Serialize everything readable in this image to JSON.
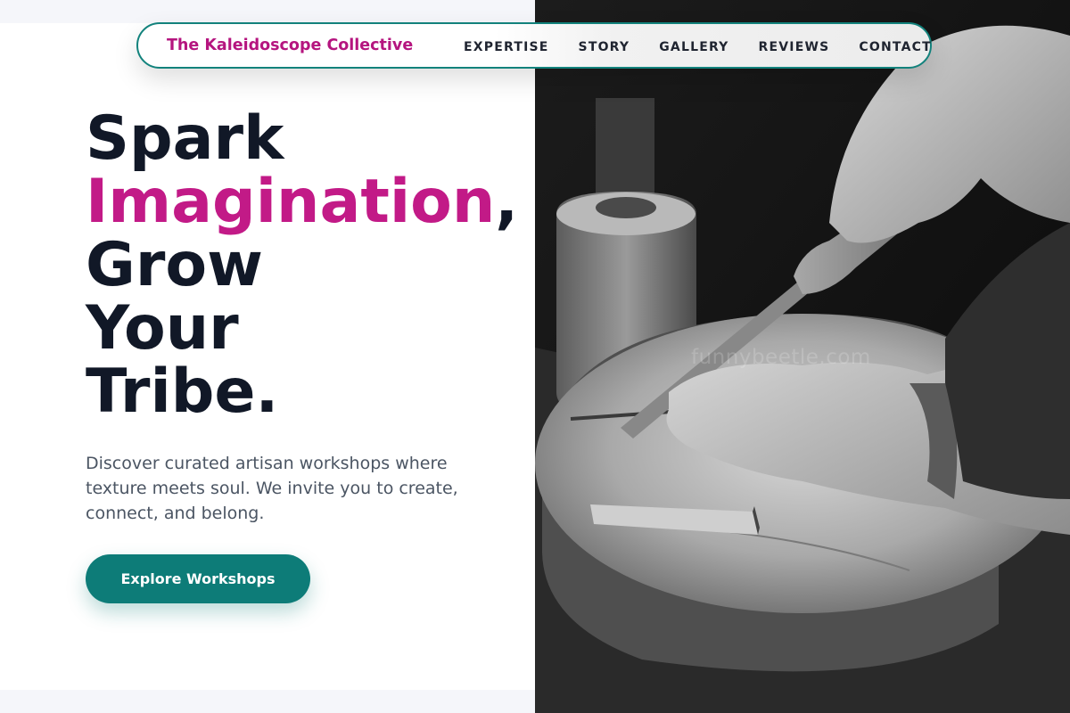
{
  "nav": {
    "brand": "The Kaleidoscope Collective",
    "links": [
      "EXPERTISE",
      "STORY",
      "GALLERY",
      "REVIEWS",
      "CONTACT"
    ]
  },
  "hero": {
    "line1": "Spark",
    "line2": "Imagination",
    "line2_punct": ",",
    "line3": "Grow",
    "line4": "Your",
    "line5": "Tribe.",
    "description": "Discover curated artisan workshops where texture meets soul. We invite you to create, connect, and belong.",
    "cta_label": "Explore Workshops"
  },
  "image": {
    "watermark": "funnybeetle.com",
    "subject": "woodcarving-hands-photo"
  },
  "colors": {
    "brand_magenta": "#c21a87",
    "accent_teal": "#0d7c78",
    "heading_dark": "#111827"
  }
}
